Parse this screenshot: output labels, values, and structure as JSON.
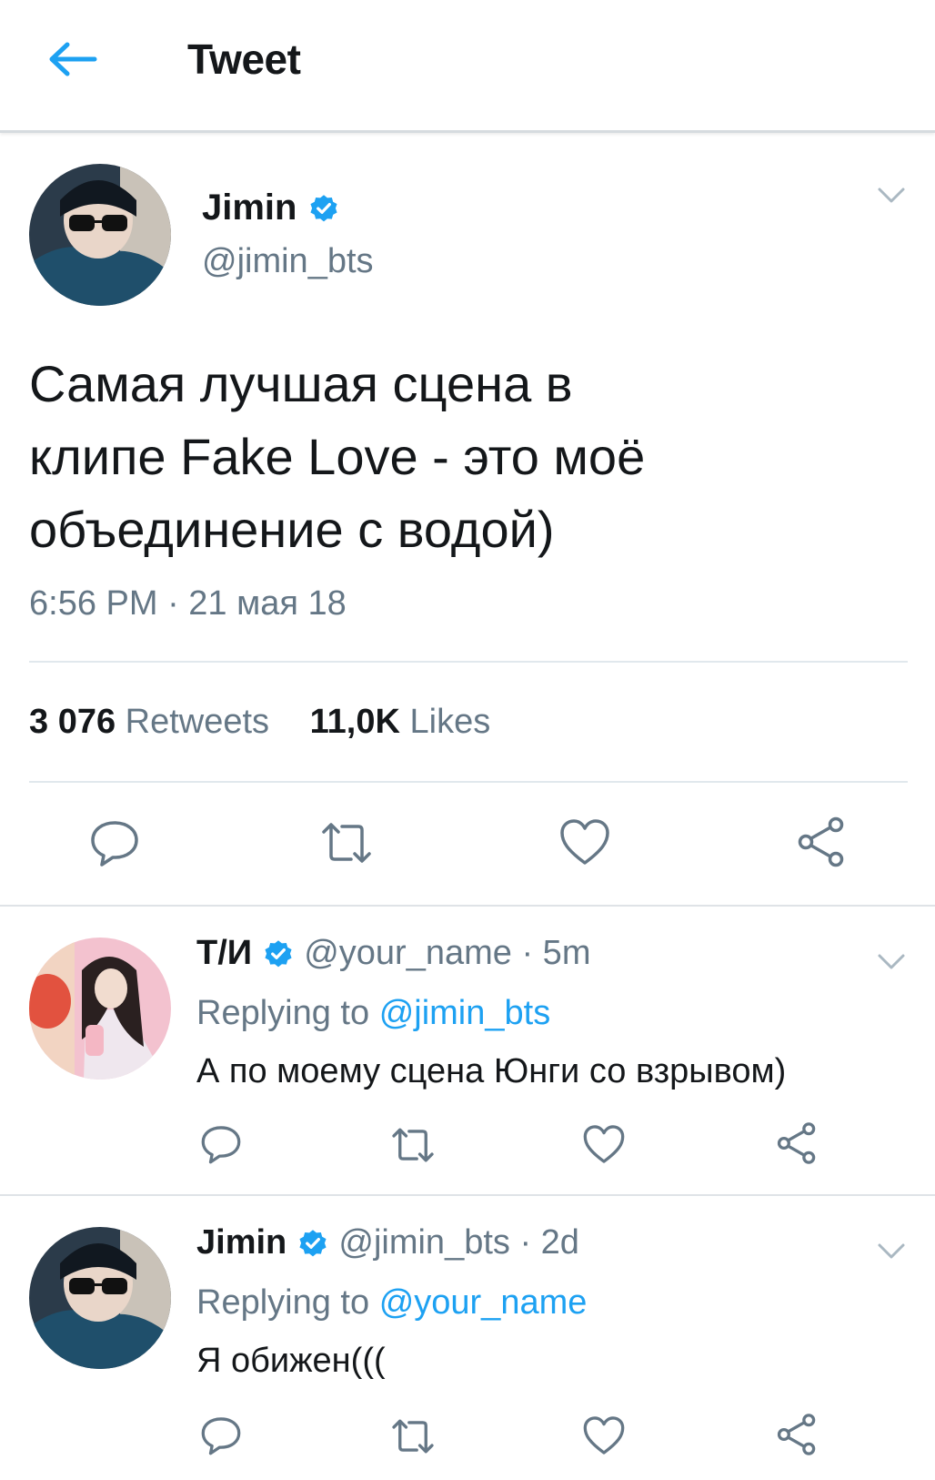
{
  "header": {
    "title": "Tweet"
  },
  "tweet": {
    "name": "Jimin",
    "handle": "@jimin_bts",
    "text_line1": "Самая лучшая сцена в",
    "text_line2": "клипе Fake Love - это моё",
    "text_line3": "объединение с водой)",
    "timestamp": "6:56 PM · 21 мая 18",
    "retweets_count": "3 076",
    "retweets_label": "Retweets",
    "likes_count": "11,0K",
    "likes_label": "Likes"
  },
  "replies": [
    {
      "name": "Т/И",
      "handle": "@your_name",
      "time": "· 5m",
      "replying_prefix": "Replying to",
      "replying_to": "@jimin_bts",
      "text": "А по моему сцена Юнги со взрывом)"
    },
    {
      "name": "Jimin",
      "handle": "@jimin_bts",
      "time": "· 2d",
      "replying_prefix": "Replying to",
      "replying_to": "@your_name",
      "text": "Я обижен((("
    }
  ],
  "colors": {
    "accent": "#1da1f2",
    "secondary_text": "#657786",
    "icon": "#657786",
    "verified": "#1da1f2"
  },
  "icons": [
    "back-arrow-icon",
    "verified-badge-icon",
    "chevron-down-icon",
    "reply-icon",
    "retweet-icon",
    "like-icon",
    "share-icon"
  ]
}
